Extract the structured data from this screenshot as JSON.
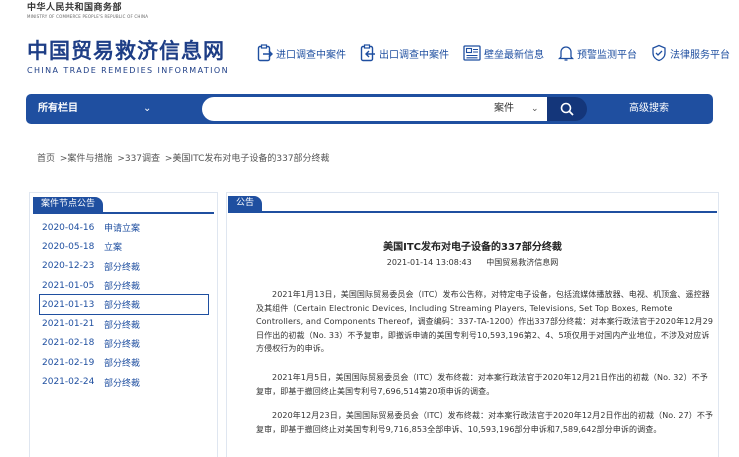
{
  "ministry": {
    "cn": "中华人民共和国商务部",
    "en": "MINISTRY OF COMMERCE PEOPLE'S REPUBLIC OF CHINA"
  },
  "logo": {
    "cn": "中国贸易救济信息网",
    "en": "CHINA TRADE REMEDIES INFORMATION"
  },
  "topnav": [
    "进口调查中案件",
    "出口调查中案件",
    "壁垒最新信息",
    "预警监测平台",
    "法律服务平台"
  ],
  "search": {
    "all_columns": "所有栏目",
    "type": "案件",
    "advanced": "高级搜索",
    "placeholder": ""
  },
  "breadcrumb": [
    "首页",
    ">案件与措施",
    ">337调查",
    ">美国ITC发布对电子设备的337部分终裁"
  ],
  "sidebar": {
    "title": "案件节点公告",
    "items": [
      {
        "date": "2020-04-16",
        "label": "申请立案"
      },
      {
        "date": "2020-05-18",
        "label": "立案"
      },
      {
        "date": "2020-12-23",
        "label": "部分终裁"
      },
      {
        "date": "2021-01-05",
        "label": "部分终裁"
      },
      {
        "date": "2021-01-13",
        "label": "部分终裁"
      },
      {
        "date": "2021-01-21",
        "label": "部分终裁"
      },
      {
        "date": "2021-02-18",
        "label": "部分终裁"
      },
      {
        "date": "2021-02-19",
        "label": "部分终裁"
      },
      {
        "date": "2021-02-24",
        "label": "部分终裁"
      }
    ]
  },
  "main": {
    "tab": "公告",
    "title": "美国ITC发布对电子设备的337部分终裁",
    "date": "2021-01-14 13:08:43",
    "source": "中国贸易救济信息网",
    "paragraphs": [
      "2021年1月13日，美国国际贸易委员会（ITC）发布公告称，对特定电子设备，包括流媒体播放器、电视、机顶盒、遥控器及其组件（Certain Electronic Devices, Including Streaming Players, Televisions, Set Top Boxes, Remote Controllers, and Components Thereof，调查编码：337-TA-1200）作出337部分终裁：对本案行政法官于2020年12月29日作出的初裁（No. 33）不予复审，即撤诉申请的美国专利号10,593,196第2、4、5项仅用于对国内产业地位，不涉及对应诉方侵权行为的申诉。",
      "2021年1月5日，美国国际贸易委员会（ITC）发布终裁：对本案行政法官于2020年12月21日作出的初裁（No. 32）不予复审，即基于撤回终止美国专利号7,696,514第20项申诉的调查。",
      "2020年12月23日，美国国际贸易委员会（ITC）发布终裁：对本案行政法官于2020年12月2日作出的初裁（No. 27）不予复审，即基于撤回终止对美国专利号9,716,853全部申诉、10,593,196部分申诉和7,589,642部分申诉的调查。"
    ]
  },
  "colors": {
    "brand": "#1f4fa0",
    "logo": "#1e3e86"
  }
}
